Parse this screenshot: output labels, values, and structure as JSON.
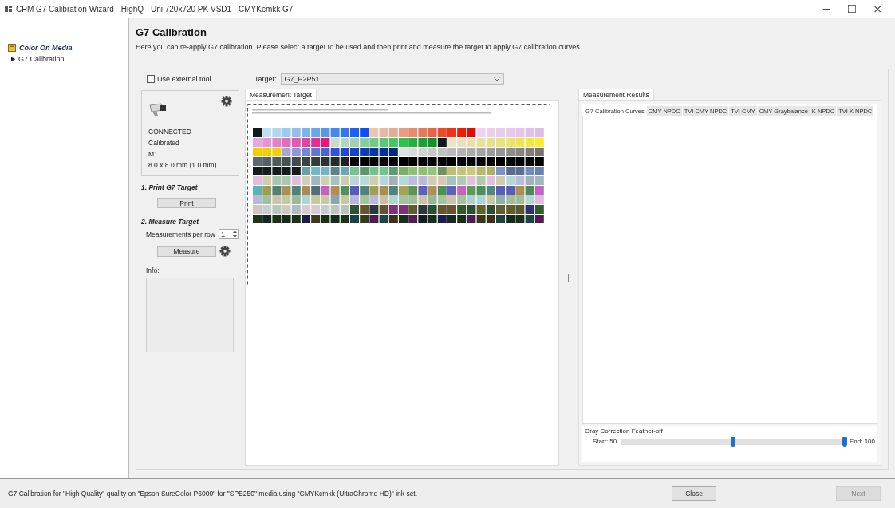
{
  "window": {
    "title": "CPM G7 Calibration Wizard - HighQ - Uni 720x720 PK VSD1 - CMYKcmkk G7",
    "controls": [
      "−",
      "☐",
      "×"
    ]
  },
  "sidebar": {
    "items": [
      {
        "label": "Color On Media",
        "children": [
          {
            "label": "G7 Calibration",
            "marker": "▶"
          }
        ]
      }
    ]
  },
  "page": {
    "title": "G7 Calibration",
    "description": "Here you can re-apply G7 calibration.  Please select a target to be used and then print and measure the target to apply G7 calibration curves."
  },
  "device": {
    "use_external_tool": {
      "label": "Use external tool",
      "checked": false
    },
    "status_lines": [
      "CONNECTED",
      "Calibrated",
      "M1",
      "8.0 x 8.0 mm (1.0 mm)"
    ],
    "print_heading": "1. Print G7 Target",
    "print_button": "Print",
    "measure_heading": "2. Measure Target",
    "measurements_label": "Measurements per row",
    "measurements_value": "1",
    "measure_button": "Measure",
    "info_label": "Info:"
  },
  "target": {
    "label": "Target:",
    "value": "G7_P2P51"
  },
  "measurement_target": {
    "tab": "Measurement Target"
  },
  "results": {
    "tab": "Measurement Results",
    "tabs": [
      {
        "label": "G7 Calibration Curves",
        "selected": true
      },
      {
        "label": "CMY NPDC",
        "selected": false
      },
      {
        "label": "TVI CMY NPDC",
        "selected": false
      },
      {
        "label": "TVI CMY",
        "selected": false
      },
      {
        "label": "CMY Graybalance",
        "selected": false
      },
      {
        "label": "K NPDC",
        "selected": false
      },
      {
        "label": "TVI K NPDC",
        "selected": false
      }
    ],
    "feather": {
      "label": "Gray Correction Feather-off",
      "start_label": "Start: 50",
      "end_label": "End: 100",
      "thumbs": [
        {
          "level": 0.5
        },
        {
          "level": 1
        }
      ]
    }
  },
  "status_bar": {
    "text": "G7 Calibration for \"High Quality\" quality on \"Epson SureColor P6000\" for \"SPB250\" media using \"CMYKcmkk (UltraChrome HD)\" ink set.",
    "buttons": [
      {
        "label": "Close",
        "disabled": false
      },
      {
        "label": "Next",
        "disabled": true
      }
    ]
  }
}
